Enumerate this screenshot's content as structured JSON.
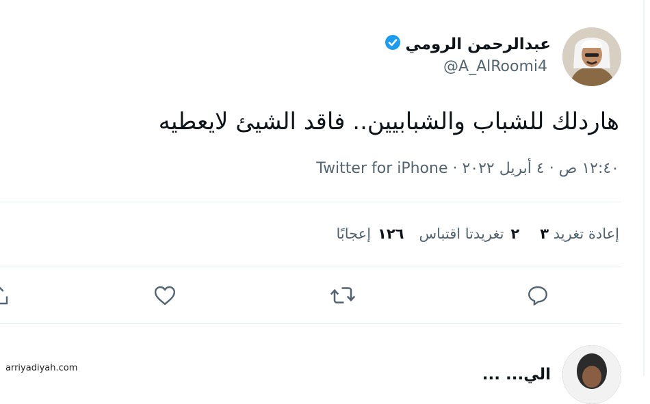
{
  "tweet": {
    "author_name": "عبدالرحمن الرومي",
    "handle": "@A_AlRoomi4",
    "verified_icon": "verified-badge-icon",
    "text": "هاردلك للشباب والشبابيين.. فاقد الشيئ لايعطيه",
    "timestamp": "١٢:٤٠ ص · ٤ أبريل ٢٠٢٢ · ",
    "source": "Twitter for iPhone"
  },
  "stats": {
    "retweets_label": "إعادة تغريد",
    "retweets_count": "٣",
    "quotes_label": "تغريدتا اقتباس",
    "quotes_count": "٢",
    "likes_label": "إعجابًا",
    "likes_count": "١٢٦"
  },
  "actions": {
    "icons": [
      "reply-icon",
      "retweet-icon",
      "like-icon",
      "share-icon"
    ]
  },
  "reply": {
    "author_name": "الي... ..."
  },
  "watermark": "arriyadiyah.com",
  "colors": {
    "verified": "#1d9bf0",
    "secondary_text": "#536471",
    "divider": "#e6ecf0"
  }
}
